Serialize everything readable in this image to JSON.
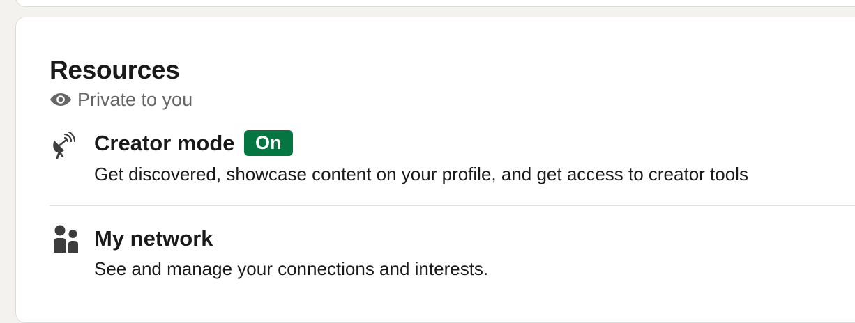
{
  "resources": {
    "title": "Resources",
    "privacy_label": "Private to you",
    "items": [
      {
        "icon": "satellite-dish-icon",
        "title": "Creator mode",
        "badge": "On",
        "description": "Get discovered, showcase content on your profile, and get access to creator tools"
      },
      {
        "icon": "people-icon",
        "title": "My network",
        "description": "See and manage your connections and interests."
      }
    ]
  },
  "colors": {
    "badge_bg": "#057642",
    "page_bg": "#f3f2ef",
    "secondary_text": "#666666"
  }
}
